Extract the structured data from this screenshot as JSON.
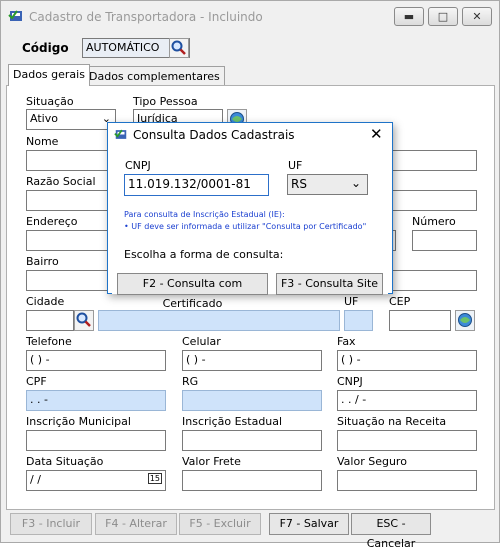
{
  "window": {
    "title": "Cadastro de Transportadora - Incluindo"
  },
  "codigo": {
    "label": "Código",
    "value": "AUTOMÁTICO"
  },
  "tabs": [
    {
      "label": "Dados gerais"
    },
    {
      "label": "Dados complementares"
    }
  ],
  "form": {
    "situacao": {
      "label": "Situação",
      "value": "Ativo"
    },
    "tipo_pessoa": {
      "label": "Tipo Pessoa",
      "value": "Jurídica"
    },
    "nome": {
      "label": "Nome"
    },
    "razao_social": {
      "label": "Razão Social"
    },
    "endereco": {
      "label": "Endereço"
    },
    "numero": {
      "label": "Número"
    },
    "bairro": {
      "label": "Bairro"
    },
    "cidade": {
      "label": "Cidade"
    },
    "uf": {
      "label": "UF"
    },
    "cep": {
      "label": "CEP"
    },
    "telefone": {
      "label": "Telefone",
      "value": "( )   -"
    },
    "celular": {
      "label": "Celular",
      "value": "( )   -"
    },
    "fax": {
      "label": "Fax",
      "value": "( )   -"
    },
    "cpf": {
      "label": "CPF",
      "value": ".   .   -"
    },
    "rg": {
      "label": "RG"
    },
    "cnpj": {
      "label": "CNPJ",
      "value": ".   .   /   -"
    },
    "inscricao_municipal": {
      "label": "Inscrição Municipal"
    },
    "inscricao_estadual": {
      "label": "Inscrição Estadual"
    },
    "situacao_receita": {
      "label": "Situação na Receita"
    },
    "data_situacao": {
      "label": "Data Situação",
      "value": " / /"
    },
    "valor_frete": {
      "label": "Valor Frete"
    },
    "valor_seguro": {
      "label": "Valor Seguro"
    }
  },
  "buttons": {
    "incluir": "F3 - Incluir",
    "alterar": "F4 - Alterar",
    "excluir": "F5 - Excluir",
    "salvar": "F7 - Salvar",
    "cancelar": "ESC - Cancelar"
  },
  "dialog": {
    "title": "Consulta Dados Cadastrais",
    "cnpj_label": "CNPJ",
    "cnpj_value": "11.019.132/0001-81",
    "uf_label": "UF",
    "uf_value": "RS",
    "info_line1": "Para consulta de Inscrição Estadual (IE):",
    "info_line2": "• UF deve ser informada e utilizar \"Consulta por Certificado\"",
    "prompt": "Escolha a forma de consulta:",
    "btn_certificado": "F2 - Consulta com Certificado",
    "btn_site": "F3 - Consulta Site"
  }
}
